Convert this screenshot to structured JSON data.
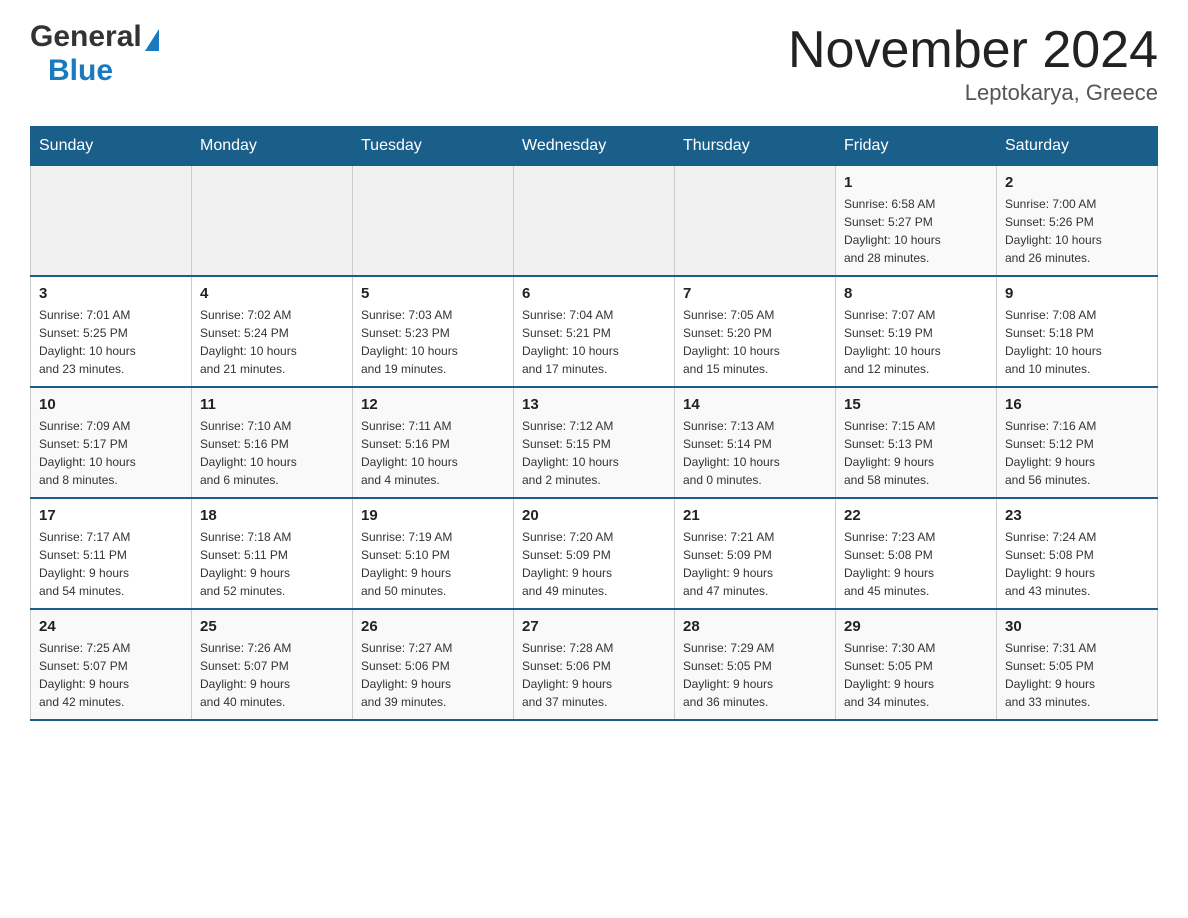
{
  "header": {
    "logo_general": "General",
    "logo_blue": "Blue",
    "title": "November 2024",
    "subtitle": "Leptokarya, Greece"
  },
  "weekdays": [
    "Sunday",
    "Monday",
    "Tuesday",
    "Wednesday",
    "Thursday",
    "Friday",
    "Saturday"
  ],
  "weeks": [
    [
      {
        "day": "",
        "info": ""
      },
      {
        "day": "",
        "info": ""
      },
      {
        "day": "",
        "info": ""
      },
      {
        "day": "",
        "info": ""
      },
      {
        "day": "",
        "info": ""
      },
      {
        "day": "1",
        "info": "Sunrise: 6:58 AM\nSunset: 5:27 PM\nDaylight: 10 hours\nand 28 minutes."
      },
      {
        "day": "2",
        "info": "Sunrise: 7:00 AM\nSunset: 5:26 PM\nDaylight: 10 hours\nand 26 minutes."
      }
    ],
    [
      {
        "day": "3",
        "info": "Sunrise: 7:01 AM\nSunset: 5:25 PM\nDaylight: 10 hours\nand 23 minutes."
      },
      {
        "day": "4",
        "info": "Sunrise: 7:02 AM\nSunset: 5:24 PM\nDaylight: 10 hours\nand 21 minutes."
      },
      {
        "day": "5",
        "info": "Sunrise: 7:03 AM\nSunset: 5:23 PM\nDaylight: 10 hours\nand 19 minutes."
      },
      {
        "day": "6",
        "info": "Sunrise: 7:04 AM\nSunset: 5:21 PM\nDaylight: 10 hours\nand 17 minutes."
      },
      {
        "day": "7",
        "info": "Sunrise: 7:05 AM\nSunset: 5:20 PM\nDaylight: 10 hours\nand 15 minutes."
      },
      {
        "day": "8",
        "info": "Sunrise: 7:07 AM\nSunset: 5:19 PM\nDaylight: 10 hours\nand 12 minutes."
      },
      {
        "day": "9",
        "info": "Sunrise: 7:08 AM\nSunset: 5:18 PM\nDaylight: 10 hours\nand 10 minutes."
      }
    ],
    [
      {
        "day": "10",
        "info": "Sunrise: 7:09 AM\nSunset: 5:17 PM\nDaylight: 10 hours\nand 8 minutes."
      },
      {
        "day": "11",
        "info": "Sunrise: 7:10 AM\nSunset: 5:16 PM\nDaylight: 10 hours\nand 6 minutes."
      },
      {
        "day": "12",
        "info": "Sunrise: 7:11 AM\nSunset: 5:16 PM\nDaylight: 10 hours\nand 4 minutes."
      },
      {
        "day": "13",
        "info": "Sunrise: 7:12 AM\nSunset: 5:15 PM\nDaylight: 10 hours\nand 2 minutes."
      },
      {
        "day": "14",
        "info": "Sunrise: 7:13 AM\nSunset: 5:14 PM\nDaylight: 10 hours\nand 0 minutes."
      },
      {
        "day": "15",
        "info": "Sunrise: 7:15 AM\nSunset: 5:13 PM\nDaylight: 9 hours\nand 58 minutes."
      },
      {
        "day": "16",
        "info": "Sunrise: 7:16 AM\nSunset: 5:12 PM\nDaylight: 9 hours\nand 56 minutes."
      }
    ],
    [
      {
        "day": "17",
        "info": "Sunrise: 7:17 AM\nSunset: 5:11 PM\nDaylight: 9 hours\nand 54 minutes."
      },
      {
        "day": "18",
        "info": "Sunrise: 7:18 AM\nSunset: 5:11 PM\nDaylight: 9 hours\nand 52 minutes."
      },
      {
        "day": "19",
        "info": "Sunrise: 7:19 AM\nSunset: 5:10 PM\nDaylight: 9 hours\nand 50 minutes."
      },
      {
        "day": "20",
        "info": "Sunrise: 7:20 AM\nSunset: 5:09 PM\nDaylight: 9 hours\nand 49 minutes."
      },
      {
        "day": "21",
        "info": "Sunrise: 7:21 AM\nSunset: 5:09 PM\nDaylight: 9 hours\nand 47 minutes."
      },
      {
        "day": "22",
        "info": "Sunrise: 7:23 AM\nSunset: 5:08 PM\nDaylight: 9 hours\nand 45 minutes."
      },
      {
        "day": "23",
        "info": "Sunrise: 7:24 AM\nSunset: 5:08 PM\nDaylight: 9 hours\nand 43 minutes."
      }
    ],
    [
      {
        "day": "24",
        "info": "Sunrise: 7:25 AM\nSunset: 5:07 PM\nDaylight: 9 hours\nand 42 minutes."
      },
      {
        "day": "25",
        "info": "Sunrise: 7:26 AM\nSunset: 5:07 PM\nDaylight: 9 hours\nand 40 minutes."
      },
      {
        "day": "26",
        "info": "Sunrise: 7:27 AM\nSunset: 5:06 PM\nDaylight: 9 hours\nand 39 minutes."
      },
      {
        "day": "27",
        "info": "Sunrise: 7:28 AM\nSunset: 5:06 PM\nDaylight: 9 hours\nand 37 minutes."
      },
      {
        "day": "28",
        "info": "Sunrise: 7:29 AM\nSunset: 5:05 PM\nDaylight: 9 hours\nand 36 minutes."
      },
      {
        "day": "29",
        "info": "Sunrise: 7:30 AM\nSunset: 5:05 PM\nDaylight: 9 hours\nand 34 minutes."
      },
      {
        "day": "30",
        "info": "Sunrise: 7:31 AM\nSunset: 5:05 PM\nDaylight: 9 hours\nand 33 minutes."
      }
    ]
  ]
}
